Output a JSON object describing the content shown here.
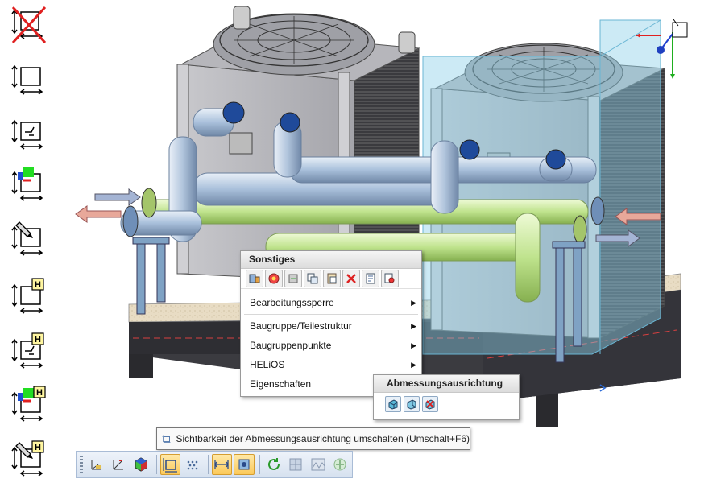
{
  "left_toolbar": {
    "icons": [
      {
        "name": "dimension-disabled-icon"
      },
      {
        "name": "dimension-box-icon"
      },
      {
        "name": "dimension-section-icon"
      },
      {
        "name": "dimension-color-icon"
      },
      {
        "name": "dimension-pencil-icon"
      },
      {
        "name": "dimension-h-icon",
        "badge": "H"
      },
      {
        "name": "dimension-section-h-icon",
        "badge": "H"
      },
      {
        "name": "dimension-color-h-icon",
        "badge": "H"
      },
      {
        "name": "dimension-pencil-h-icon",
        "badge": "H"
      }
    ]
  },
  "context_menu": {
    "title": "Sonstiges",
    "items": [
      {
        "label": "Bearbeitungssperre",
        "submenu": true
      },
      {
        "label": "Baugruppe/Teilestruktur",
        "submenu": true
      },
      {
        "label": "Baugruppenpunkte",
        "submenu": true
      },
      {
        "label": "HELiOS",
        "submenu": true
      },
      {
        "label": "Eigenschaften",
        "submenu": false
      }
    ],
    "arrow_glyph": "▶"
  },
  "submenu": {
    "title": "Abmessungsausrichtung"
  },
  "tooltip": {
    "text": "Sichtbarkeit der Abmessungsausrichtung umschalten (Umschalt+F6)"
  },
  "colors": {
    "selection_box": "#8fd0e8",
    "toolbar_active": "#fbc95a",
    "pipe_blue": "#a9c6e6",
    "pipe_green": "#b8e08a"
  }
}
